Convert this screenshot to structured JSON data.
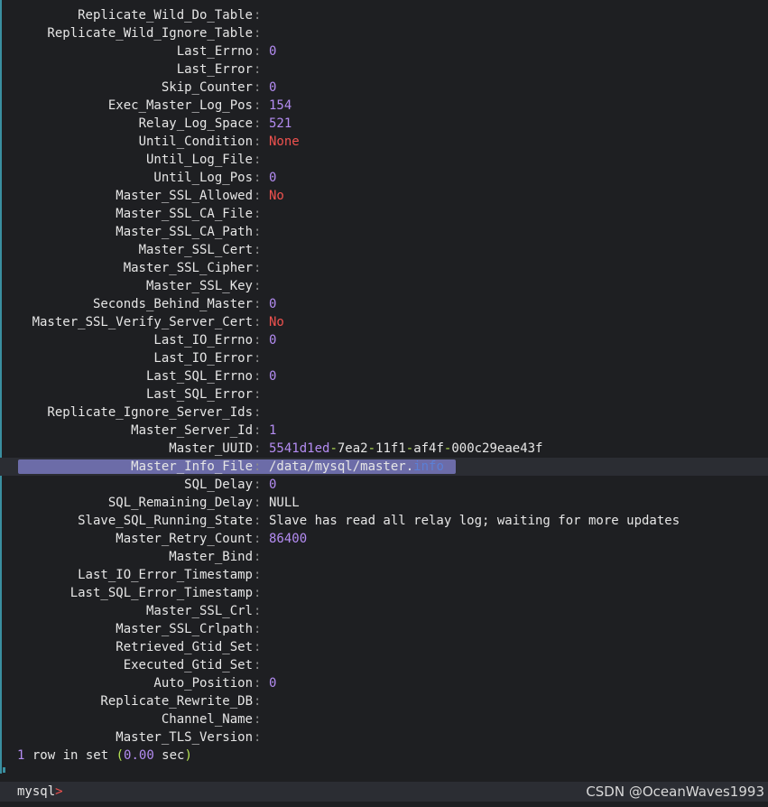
{
  "rows": [
    {
      "key": "Replicate_Wild_Do_Table",
      "value": "",
      "type": "plain"
    },
    {
      "key": "Replicate_Wild_Ignore_Table",
      "value": "",
      "type": "plain"
    },
    {
      "key": "Last_Errno",
      "value": "0",
      "type": "num"
    },
    {
      "key": "Last_Error",
      "value": "",
      "type": "plain"
    },
    {
      "key": "Skip_Counter",
      "value": "0",
      "type": "num"
    },
    {
      "key": "Exec_Master_Log_Pos",
      "value": "154",
      "type": "num"
    },
    {
      "key": "Relay_Log_Space",
      "value": "521",
      "type": "num"
    },
    {
      "key": "Until_Condition",
      "value": "None",
      "type": "red"
    },
    {
      "key": "Until_Log_File",
      "value": "",
      "type": "plain"
    },
    {
      "key": "Until_Log_Pos",
      "value": "0",
      "type": "num"
    },
    {
      "key": "Master_SSL_Allowed",
      "value": "No",
      "type": "red"
    },
    {
      "key": "Master_SSL_CA_File",
      "value": "",
      "type": "plain"
    },
    {
      "key": "Master_SSL_CA_Path",
      "value": "",
      "type": "plain"
    },
    {
      "key": "Master_SSL_Cert",
      "value": "",
      "type": "plain"
    },
    {
      "key": "Master_SSL_Cipher",
      "value": "",
      "type": "plain"
    },
    {
      "key": "Master_SSL_Key",
      "value": "",
      "type": "plain"
    },
    {
      "key": "Seconds_Behind_Master",
      "value": "0",
      "type": "num"
    },
    {
      "key": "Master_SSL_Verify_Server_Cert",
      "value": "No",
      "type": "red"
    },
    {
      "key": "Last_IO_Errno",
      "value": "0",
      "type": "num"
    },
    {
      "key": "Last_IO_Error",
      "value": "",
      "type": "plain"
    },
    {
      "key": "Last_SQL_Errno",
      "value": "0",
      "type": "num"
    },
    {
      "key": "Last_SQL_Error",
      "value": "",
      "type": "plain"
    },
    {
      "key": "Replicate_Ignore_Server_Ids",
      "value": "",
      "type": "plain"
    },
    {
      "key": "Master_Server_Id",
      "value": "1",
      "type": "num"
    },
    {
      "key": "Master_UUID",
      "type": "segments",
      "segments": [
        {
          "text": "5541d1ed",
          "color": "num"
        },
        {
          "text": "-",
          "color": "green"
        },
        {
          "text": "7ea2",
          "color": "plain"
        },
        {
          "text": "-",
          "color": "green"
        },
        {
          "text": "11f1",
          "color": "plain"
        },
        {
          "text": "-",
          "color": "green"
        },
        {
          "text": "af4f",
          "color": "plain"
        },
        {
          "text": "-",
          "color": "green"
        },
        {
          "text": "000c29eae43f",
          "color": "plain"
        }
      ]
    },
    {
      "key": "Master_Info_File",
      "type": "segments",
      "current": true,
      "segments": [
        {
          "text": "/data/mysql/master.",
          "color": "plain"
        },
        {
          "text": "info",
          "color": "blue"
        }
      ]
    },
    {
      "key": "SQL_Delay",
      "value": "0",
      "type": "num"
    },
    {
      "key": "SQL_Remaining_Delay",
      "value": "NULL",
      "type": "plain"
    },
    {
      "key": "Slave_SQL_Running_State",
      "value": "Slave has read all relay log; waiting for more updates",
      "type": "plain"
    },
    {
      "key": "Master_Retry_Count",
      "value": "86400",
      "type": "num"
    },
    {
      "key": "Master_Bind",
      "value": "",
      "type": "plain"
    },
    {
      "key": "Last_IO_Error_Timestamp",
      "value": "",
      "type": "plain"
    },
    {
      "key": "Last_SQL_Error_Timestamp",
      "value": "",
      "type": "plain"
    },
    {
      "key": "Master_SSL_Crl",
      "value": "",
      "type": "plain"
    },
    {
      "key": "Master_SSL_Crlpath",
      "value": "",
      "type": "plain"
    },
    {
      "key": "Retrieved_Gtid_Set",
      "value": "",
      "type": "plain"
    },
    {
      "key": "Executed_Gtid_Set",
      "value": "",
      "type": "plain"
    },
    {
      "key": "Auto_Position",
      "value": "0",
      "type": "num"
    },
    {
      "key": "Replicate_Rewrite_DB",
      "value": "",
      "type": "plain"
    },
    {
      "key": "Channel_Name",
      "value": "",
      "type": "plain"
    },
    {
      "key": "Master_TLS_Version",
      "value": "",
      "type": "plain"
    }
  ],
  "summary": {
    "count": "1",
    "text": " row in set ",
    "open_paren": "(",
    "time": "0.00",
    "unit": " sec",
    "close_paren": ")"
  },
  "prompt": {
    "label": "mysql",
    "arrow": ">"
  },
  "watermark": "CSDN @OceanWaves1993",
  "colors": {
    "background": "#1e1f22",
    "number": "#b48cf2",
    "keyword_red": "#f0524f",
    "separator_green": "#b6e354",
    "selection": "#6c6ca8",
    "accent_rule": "#3a8fa0"
  }
}
